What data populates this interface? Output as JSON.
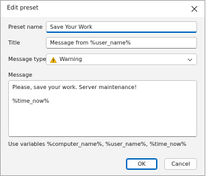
{
  "window": {
    "title": "Edit preset"
  },
  "icons": {
    "close": "close-icon",
    "warning": "warning-icon",
    "dropdown": "chevron-down-icon"
  },
  "form": {
    "preset_name_label": "Preset name",
    "preset_name_value": "Save Your Work",
    "title_label": "Title",
    "title_value": "Message from %user_name%",
    "message_type_label": "Message type",
    "message_type_value": "Warning",
    "message_label": "Message",
    "message_lines": [
      "Please, save your work. Server maintenance!",
      "",
      "%time_now%"
    ],
    "variables_hint": "Use variables %computer_name%, %user_name%, %time_now%"
  },
  "buttons": {
    "ok": "OK",
    "cancel": "Cancel"
  },
  "colors": {
    "accent": "#0067c0",
    "warning": "#f2b600"
  }
}
